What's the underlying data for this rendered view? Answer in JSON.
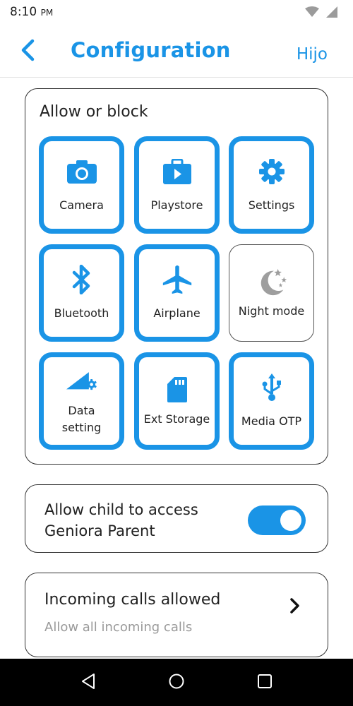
{
  "status_bar": {
    "time": "8:10",
    "ampm": "PM",
    "icons": [
      "wifi-icon",
      "signal-icon"
    ]
  },
  "header": {
    "back_icon": "chevron-left-icon",
    "title": "Configuration",
    "action": "Hijo"
  },
  "allow_block": {
    "title": "Allow or block",
    "tiles": [
      {
        "label": "Camera",
        "icon": "camera-icon",
        "enabled": true
      },
      {
        "label": "Playstore",
        "icon": "playstore-icon",
        "enabled": true
      },
      {
        "label": "Settings",
        "icon": "gear-icon",
        "enabled": true
      },
      {
        "label": "Bluetooth",
        "icon": "bluetooth-icon",
        "enabled": true
      },
      {
        "label": "Airplane",
        "icon": "airplane-icon",
        "enabled": true
      },
      {
        "label": "Night mode",
        "icon": "night-mode-icon",
        "enabled": false
      },
      {
        "label": "Data setting",
        "icon": "data-setting-icon",
        "enabled": true
      },
      {
        "label": "Ext Storage",
        "icon": "sd-card-icon",
        "enabled": true
      },
      {
        "label": "Media OTP",
        "icon": "usb-icon",
        "enabled": true
      }
    ]
  },
  "child_access": {
    "label": "Allow child to access Geniora Parent",
    "enabled": true
  },
  "incoming_calls": {
    "title": "Incoming calls allowed",
    "subtitle": "Allow all incoming calls"
  },
  "colors": {
    "accent": "#1a94e6",
    "disabled_icon": "#9e9e9e",
    "nav_bar": "#000000"
  },
  "nav_bar": {
    "buttons": [
      "back-triangle-icon",
      "home-circle-icon",
      "recents-square-icon"
    ]
  }
}
